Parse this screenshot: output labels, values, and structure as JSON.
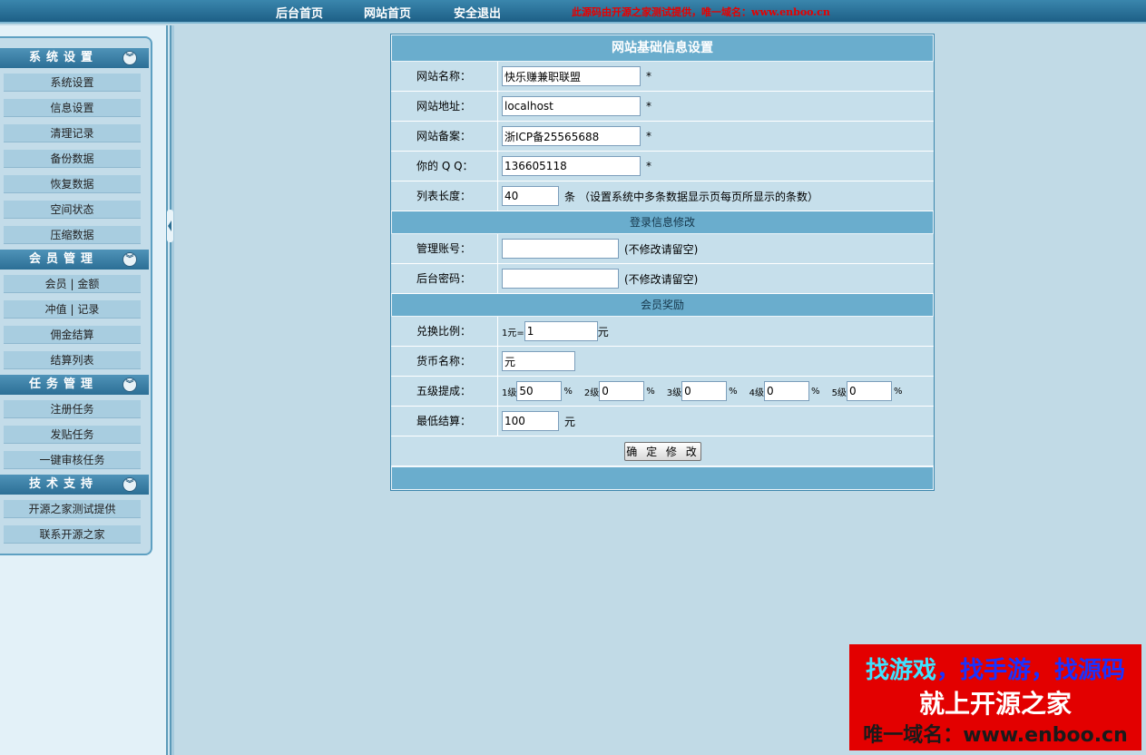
{
  "topnav": {
    "home_admin": "后台首页",
    "home_site": "网站首页",
    "logout": "安全退出",
    "notice": "此源码由开源之家测试提供，唯一域名：www.enboo.cn"
  },
  "sidebar": {
    "groups": [
      {
        "title": "系统设置",
        "items": [
          "系统设置",
          "信息设置",
          "清理记录",
          "备份数据",
          "恢复数据",
          "空间状态",
          "压缩数据"
        ]
      },
      {
        "title": "会员管理",
        "items": [
          "会员 | 金额",
          "冲值 | 记录",
          "佣金结算",
          "结算列表"
        ]
      },
      {
        "title": "任务管理",
        "items": [
          "注册任务",
          "发贴任务",
          "一键审核任务"
        ]
      },
      {
        "title": "技术支持",
        "items": [
          "开源之家测试提供",
          "联系开源之家"
        ]
      }
    ]
  },
  "form": {
    "title": "网站基础信息设置",
    "site_name": {
      "label": "网站名称：",
      "value": "快乐赚兼职联盟"
    },
    "site_url": {
      "label": "网站地址：",
      "value": "localhost"
    },
    "site_icp": {
      "label": "网站备案：",
      "value": "浙ICP备25565688"
    },
    "qq": {
      "label": "你的 Q Q：",
      "value": "136605118"
    },
    "list_len": {
      "label": "列表长度：",
      "value": "40",
      "unit": "条",
      "hint": "（设置系统中多条数据显示页每页所显示的条数）"
    },
    "required_mark": "*",
    "login_section": "登录信息修改",
    "admin_user": {
      "label": "管理账号：",
      "value": "",
      "hint": "(不修改请留空)"
    },
    "admin_pass": {
      "label": "后台密码：",
      "value": "",
      "hint": "(不修改请留空)"
    },
    "reward_section": "会员奖励",
    "exchange": {
      "label": "兑换比例：",
      "prefix": "1元=",
      "value": "1",
      "unit": "元"
    },
    "currency": {
      "label": "货币名称：",
      "value": "元"
    },
    "commission": {
      "label": "五级提成：",
      "levels": [
        {
          "name": "1级",
          "value": "50"
        },
        {
          "name": "2级",
          "value": "0"
        },
        {
          "name": "3级",
          "value": "0"
        },
        {
          "name": "4级",
          "value": "0"
        },
        {
          "name": "5级",
          "value": "0"
        }
      ],
      "unit": "%"
    },
    "min_settle": {
      "label": "最低结算：",
      "value": "100",
      "unit": "元"
    },
    "submit": "确 定 修 改"
  },
  "ad": {
    "line1_a": "找游戏",
    "line1_b": "，找手游，找源码",
    "line2": "就上开源之家",
    "line3": "唯一域名：www.enboo.cn"
  }
}
